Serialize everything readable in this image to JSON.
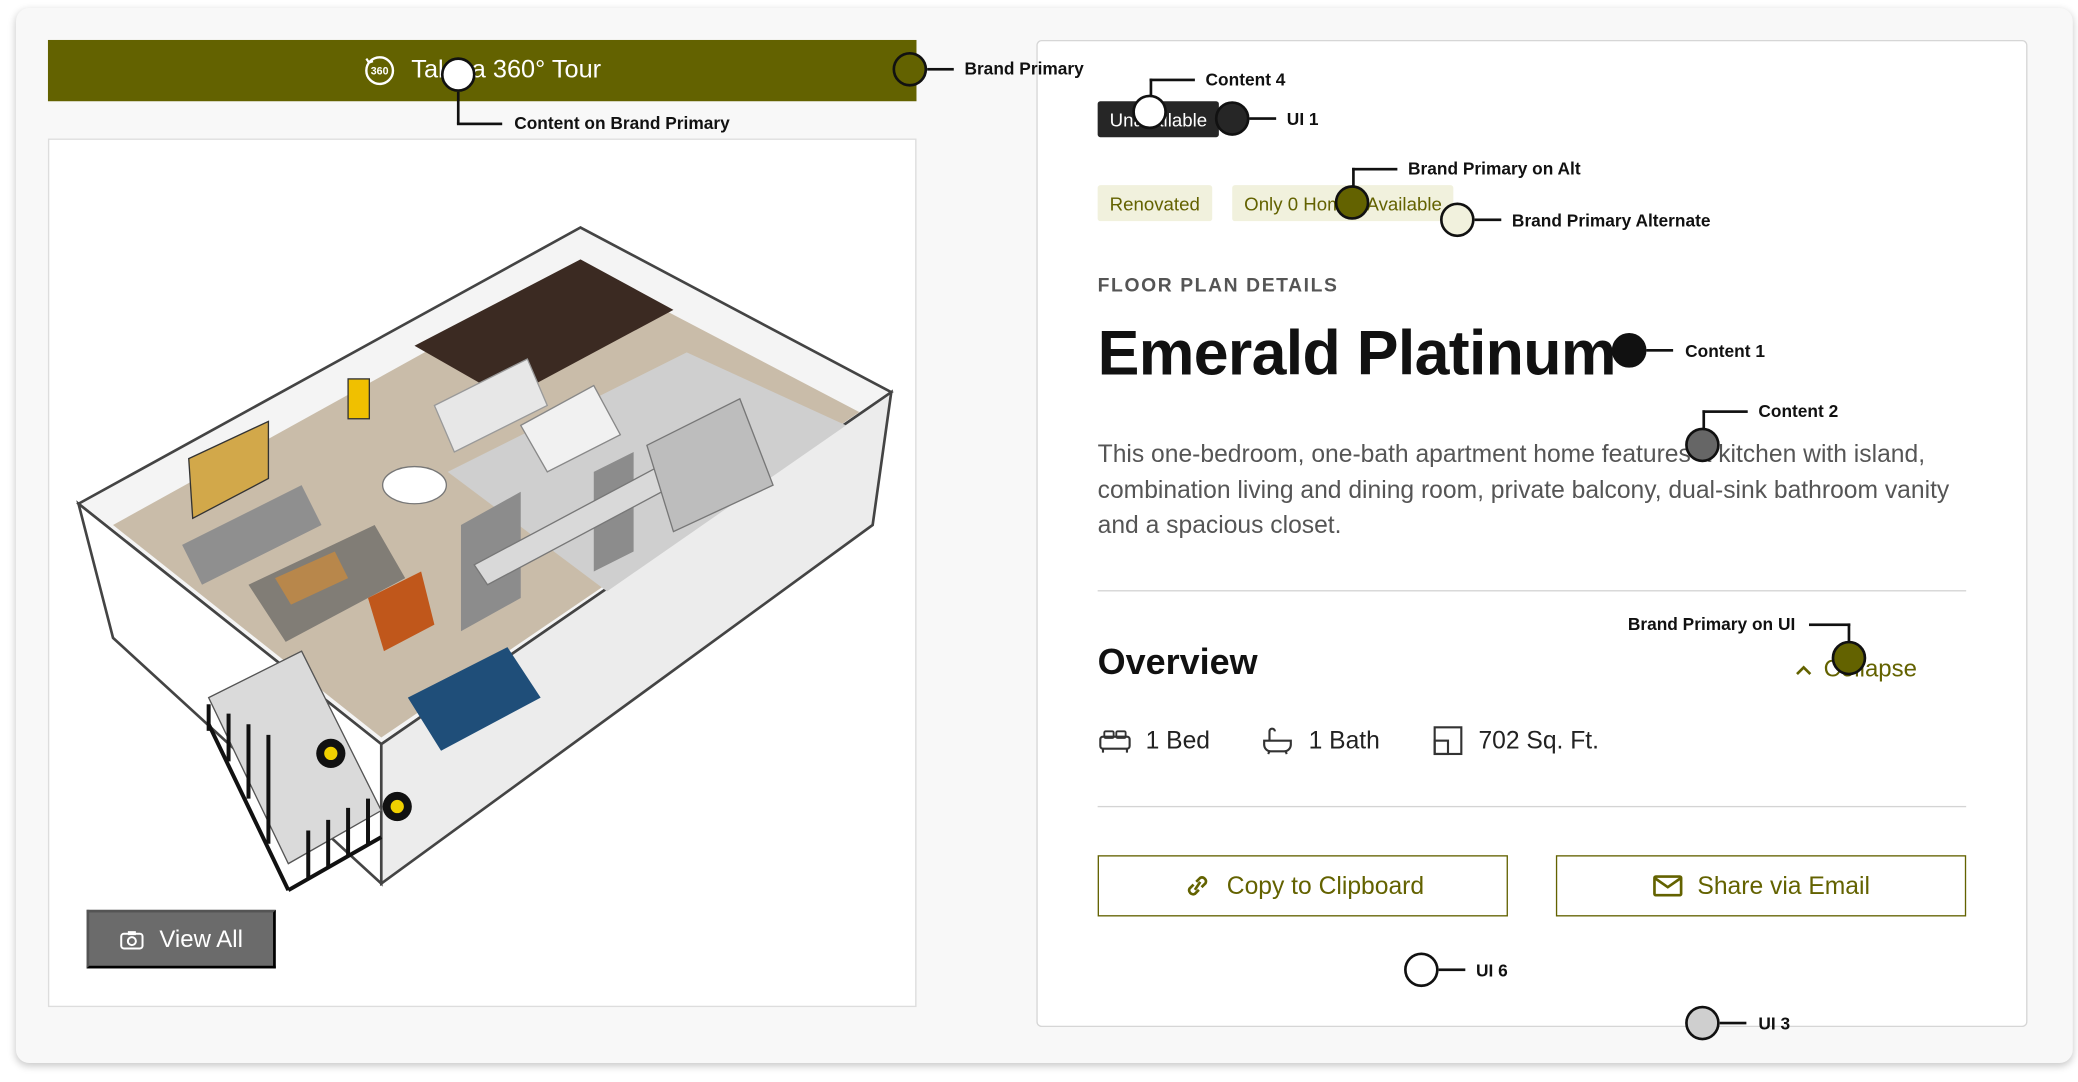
{
  "colors": {
    "brand_primary": "#636200",
    "brand_primary_on_alt": "#636200",
    "brand_primary_alternate": "#f1f1dd",
    "brand_primary_on_ui": "#636200",
    "content_on_brand_primary": "#ffffff",
    "content_1": "#111111",
    "content_2": "#666666",
    "content_4": "#ffffff",
    "ui_1": "#262626",
    "ui_3": "#cfcfcf",
    "ui_6": "#ffffff"
  },
  "tour": {
    "label": "Take a 360° Tour",
    "icon": "360-icon"
  },
  "gallery": {
    "view_all_label": "View All",
    "icon": "camera-icon"
  },
  "details": {
    "unavailable_badge": "Unavailable",
    "chips": [
      "Renovated",
      "Only 0 Homes Available"
    ],
    "eyebrow": "FLOOR PLAN DETAILS",
    "title": "Emerald Platinum",
    "description": "This one-bedroom, one-bath apartment home features a kitchen with island, combination living and dining room, private balcony, dual-sink bathroom vanity and a spacious closet.",
    "overview": {
      "title": "Overview",
      "collapse_label": "Collapse",
      "features": [
        {
          "icon": "bed-icon",
          "label": "1 Bed"
        },
        {
          "icon": "bath-icon",
          "label": "1 Bath"
        },
        {
          "icon": "area-icon",
          "label": "702 Sq. Ft."
        }
      ]
    },
    "actions": {
      "copy_label": "Copy to Clipboard",
      "email_label": "Share via Email"
    }
  },
  "annotations": {
    "brand_primary": "Brand Primary",
    "content_on_brand_primary": "Content on Brand Primary",
    "content_4": "Content 4",
    "ui_1": "UI 1",
    "brand_primary_on_alt": "Brand Primary on Alt",
    "brand_primary_alternate": "Brand Primary Alternate",
    "content_1": "Content 1",
    "content_2": "Content 2",
    "brand_primary_on_ui": "Brand Primary on UI",
    "ui_6": "UI 6",
    "ui_3": "UI 3"
  }
}
